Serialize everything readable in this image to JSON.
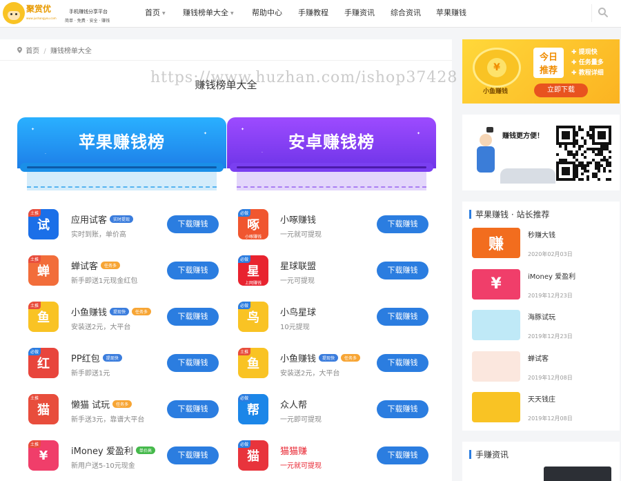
{
  "header": {
    "logo_text": "聚赏优",
    "logo_url_text": "www.jushangyou.com",
    "slogan1": "手机赚钱分享平台",
    "slogan2": "简单 · 免费 · 安全 · 赚钱",
    "nav": [
      {
        "label": "首页",
        "has_caret": true
      },
      {
        "label": "赚钱榜单大全",
        "has_caret": true
      },
      {
        "label": "帮助中心",
        "has_caret": false
      },
      {
        "label": "手赚教程",
        "has_caret": false
      },
      {
        "label": "手赚资讯",
        "has_caret": false
      },
      {
        "label": "综合资讯",
        "has_caret": false
      },
      {
        "label": "苹果赚钱",
        "has_caret": false
      }
    ],
    "search_icon": "search-icon"
  },
  "breadcrumb": {
    "icon": "location-pin-icon",
    "home": "首页",
    "sep": "/",
    "current": "赚钱榜单大全"
  },
  "page_title": "赚钱榜单大全",
  "watermark": "https://www.huzhan.com/ishop37428",
  "banners": [
    {
      "title": "苹果赚钱榜",
      "color": "#1f8ff0"
    },
    {
      "title": "安卓赚钱榜",
      "color": "#7a3ff0"
    }
  ],
  "download_label": "下载赚钱",
  "apps_left": [
    {
      "name": "应用试客",
      "desc": "实时到账，单价高",
      "badges": [
        {
          "text": "实时提现",
          "color": "#3b7ddd"
        }
      ],
      "icon_text": "试",
      "icon_bg": "#1b6fe8",
      "tag": "土推",
      "tag_color": "#e84d3c",
      "sub": ""
    },
    {
      "name": "蝉试客",
      "desc": "新手即送1元现金红包",
      "badges": [
        {
          "text": "任务多",
          "color": "#f7a534"
        }
      ],
      "icon_text": "蝉",
      "icon_bg": "#f26d3a",
      "tag": "土推",
      "tag_color": "#e84d3c",
      "sub": ""
    },
    {
      "name": "小鱼赚钱",
      "desc": "安装送2元，大平台",
      "badges": [
        {
          "text": "提现快",
          "color": "#3b7ddd"
        },
        {
          "text": "任务多",
          "color": "#f7a534"
        }
      ],
      "icon_text": "鱼",
      "icon_bg": "#f9c324",
      "tag": "土推",
      "tag_color": "#e84d3c",
      "sub": ""
    },
    {
      "name": "PP红包",
      "desc": "新手即送1元",
      "badges": [
        {
          "text": "提现快",
          "color": "#3b7ddd"
        }
      ],
      "icon_text": "红",
      "icon_bg": "#e8453c",
      "tag": "必做",
      "tag_color": "#2b7de0",
      "sub": ""
    },
    {
      "name": "懒猫 试玩",
      "desc": "新手送3元，靠谱大平台",
      "badges": [
        {
          "text": "任务多",
          "color": "#f7a534"
        }
      ],
      "icon_text": "猫",
      "icon_bg": "#e84d3c",
      "tag": "土推",
      "tag_color": "#e84d3c",
      "sub": ""
    },
    {
      "name": "iMoney 爱盈利",
      "desc": "新用户送5-10元现金",
      "badges": [
        {
          "text": "单价高",
          "color": "#45b94b"
        }
      ],
      "icon_text": "¥",
      "icon_bg": "#f03e6a",
      "tag": "土推",
      "tag_color": "#e84d3c",
      "sub": ""
    }
  ],
  "apps_right": [
    {
      "name": "小啄赚钱",
      "desc": "一元就可提现",
      "badges": [],
      "icon_text": "啄",
      "icon_bg": "#f0562f",
      "tag": "必做",
      "tag_color": "#2b7de0",
      "sub": "小啄赚钱",
      "name_color": "#333333",
      "desc_color": "#888888"
    },
    {
      "name": "星球联盟",
      "desc": "一元可提现",
      "badges": [],
      "icon_text": "星",
      "icon_bg": "#e8232f",
      "tag": "必做",
      "tag_color": "#2b7de0",
      "sub": "上网赚钱",
      "name_color": "#333333",
      "desc_color": "#888888"
    },
    {
      "name": "小鸟星球",
      "desc": "10元提现",
      "badges": [],
      "icon_text": "鸟",
      "icon_bg": "#f9c324",
      "tag": "必做",
      "tag_color": "#2b7de0",
      "sub": "",
      "name_color": "#333333",
      "desc_color": "#888888"
    },
    {
      "name": "小鱼赚钱",
      "desc": "安装送2元，大平台",
      "badges": [
        {
          "text": "提现快",
          "color": "#3b7ddd"
        },
        {
          "text": "任务多",
          "color": "#f7a534"
        }
      ],
      "icon_text": "鱼",
      "icon_bg": "#f9c324",
      "tag": "土推",
      "tag_color": "#e84d3c",
      "sub": "",
      "name_color": "#333333",
      "desc_color": "#888888"
    },
    {
      "name": "众人帮",
      "desc": "一元即可提现",
      "badges": [],
      "icon_text": "帮",
      "icon_bg": "#1b86e8",
      "tag": "必做",
      "tag_color": "#2b7de0",
      "sub": "",
      "name_color": "#333333",
      "desc_color": "#888888"
    },
    {
      "name": "猫猫赚",
      "desc": "一元就可提现",
      "badges": [],
      "icon_text": "猫",
      "icon_bg": "#e8343c",
      "tag": "必做",
      "tag_color": "#2b7de0",
      "sub": "",
      "name_color": "#e8232f",
      "desc_color": "#e8232f"
    }
  ],
  "sidebar": {
    "ad1": {
      "line1": "今日",
      "line2": "推荐",
      "features": [
        "提现快",
        "任务量多",
        "教程详细"
      ],
      "app": "小鱼赚钱",
      "button": "立即下载"
    },
    "ad2": {
      "text": "赚钱更方便！"
    },
    "rec": {
      "title": "苹果赚钱 · 站长推荐",
      "items": [
        {
          "title": "秒赚大钱",
          "date": "2020年02月03日",
          "thumb_text": "赚",
          "thumb_bg": "#f26d1e"
        },
        {
          "title": "iMoney 爱盈利",
          "date": "2019年12月23日",
          "thumb_text": "¥",
          "thumb_bg": "#f03e6a"
        },
        {
          "title": "海豚试玩",
          "date": "2019年12月23日",
          "thumb_text": "",
          "thumb_bg": "#bfe9f7"
        },
        {
          "title": "蝉试客",
          "date": "2019年12月08日",
          "thumb_text": "",
          "thumb_bg": "#fbe7de"
        },
        {
          "title": "天天钱庄",
          "date": "2019年12月08日",
          "thumb_text": "",
          "thumb_bg": "#f9c324"
        }
      ]
    },
    "news": {
      "title": "手赚资讯"
    }
  }
}
